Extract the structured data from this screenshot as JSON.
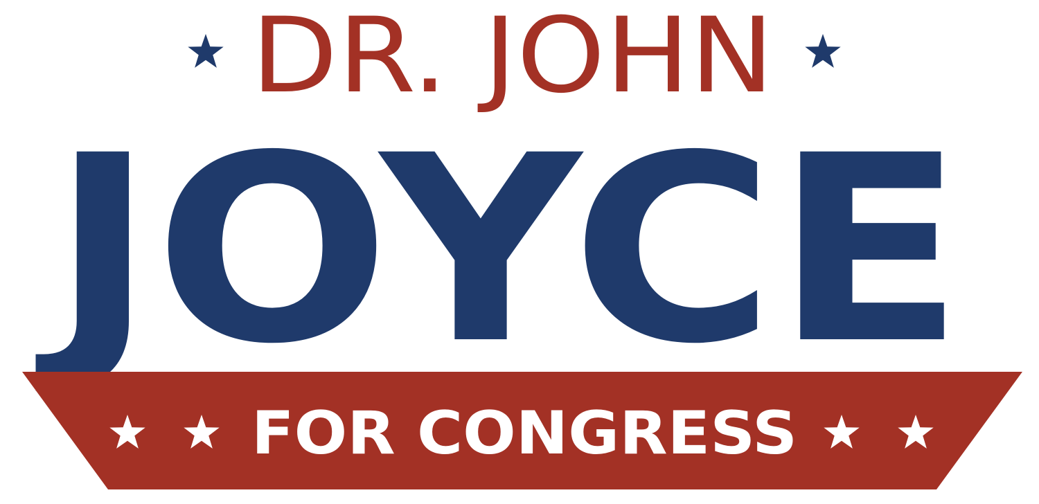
{
  "logo": {
    "top_line": "DR. JOHN",
    "name": "JOYCE",
    "banner_text": "FOR CONGRESS"
  },
  "colors": {
    "red": "#a33125",
    "navy": "#1f3a6b",
    "white": "#ffffff",
    "background": "#ffffff"
  },
  "icons": {
    "top_stars": [
      "star-icon",
      "star-icon"
    ],
    "banner_stars": [
      "star-icon",
      "star-icon",
      "star-icon",
      "star-icon"
    ]
  }
}
